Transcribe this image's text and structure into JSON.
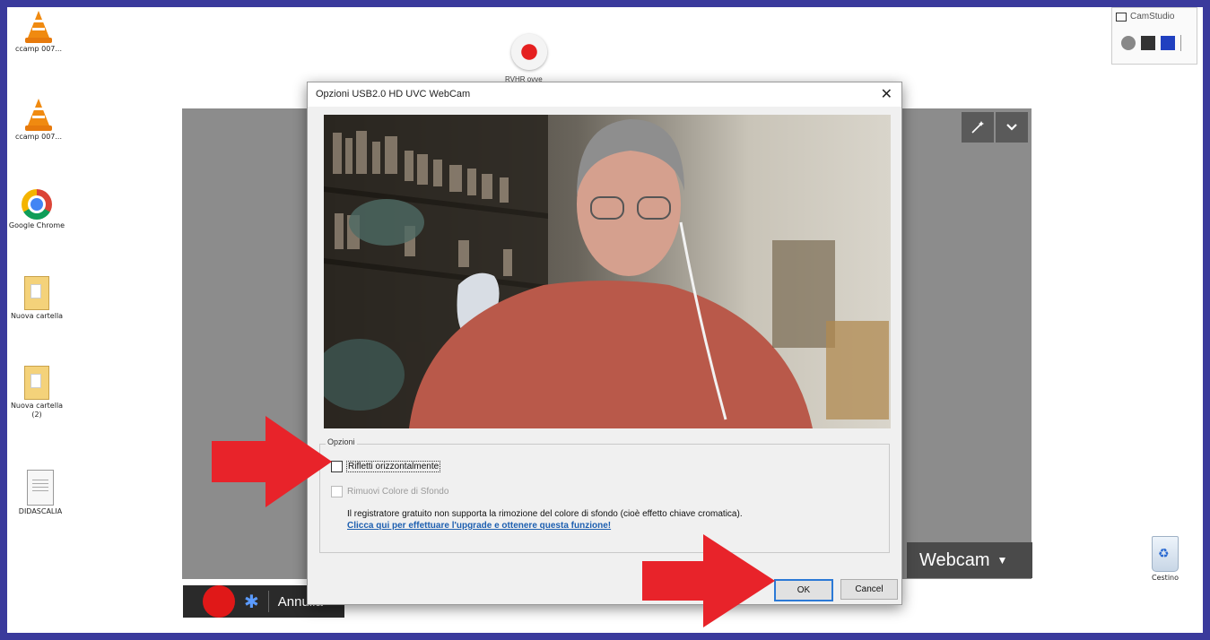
{
  "desktop": {
    "icons": [
      {
        "label": "ccamp 007..."
      },
      {
        "label": "ccamp 007..."
      },
      {
        "label": "Google Chrome"
      },
      {
        "label": "Nuova cartella"
      },
      {
        "label": "Nuova cartella (2)"
      },
      {
        "label": "DIDASCALIA"
      },
      {
        "label": "Cestino"
      }
    ],
    "record_label": "RVHR ovve"
  },
  "camstudio": {
    "title": "CamStudio"
  },
  "webcam_app": {
    "source_label": "Webcam",
    "toolbar_label": "Annulla"
  },
  "dialog": {
    "title": "Opzioni USB2.0 HD UVC WebCam",
    "close_symbol": "✕",
    "options_legend": "Opzioni",
    "mirror_label": "Rifletti orizzontalmente",
    "mirror_checked": false,
    "remove_bg_label": "Rimuovi Colore di Sfondo",
    "remove_bg_enabled": false,
    "info_text": "Il registratore gratuito non supporta la rimozione del colore di sfondo (cioè effetto chiave cromatica).",
    "upgrade_link": "Clicca qui per effettuare l'upgrade e ottenere questa funzione!",
    "ok_label": "OK",
    "cancel_label": "Cancel"
  },
  "colors": {
    "frame": "#3a3a9c",
    "arrow": "#e8232a",
    "link": "#1d5fb0",
    "record": "#e01818"
  }
}
